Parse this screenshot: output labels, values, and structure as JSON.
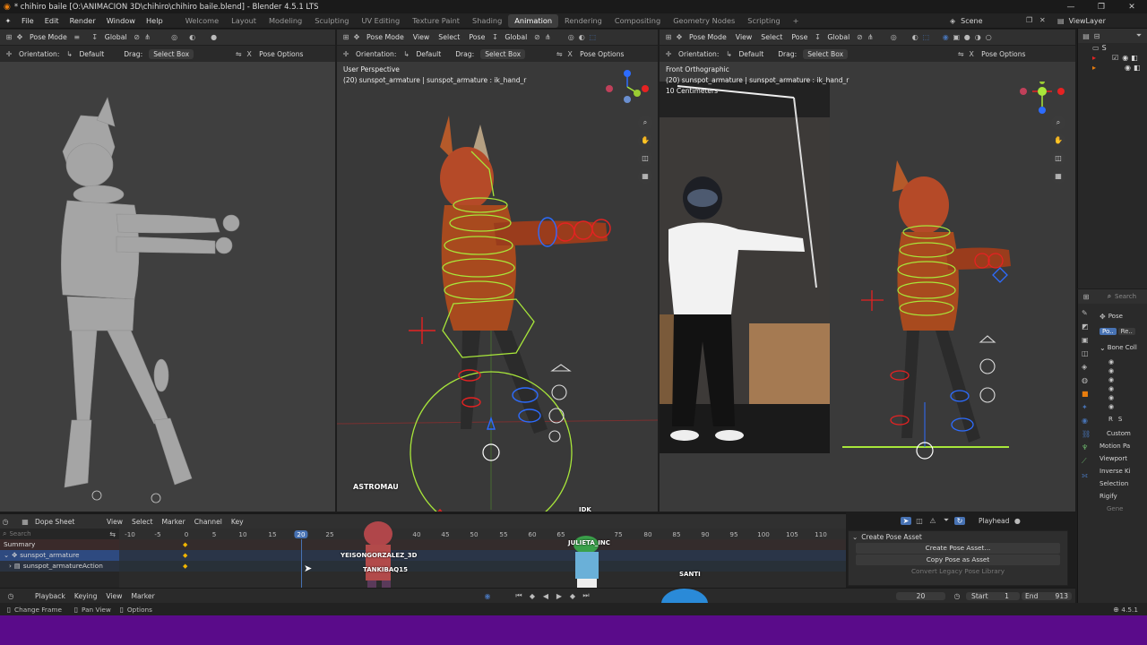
{
  "window": {
    "title": "* chihiro baile [O:\\ANIMACION 3D\\chihiro\\chihiro baile.blend] - Blender 4.5.1 LTS",
    "controls": [
      "—",
      "❐",
      "✕"
    ]
  },
  "menu": [
    "File",
    "Edit",
    "Render",
    "Window",
    "Help"
  ],
  "workspaces": [
    "Welcome",
    "Layout",
    "Modeling",
    "Sculpting",
    "UV Editing",
    "Texture Paint",
    "Shading",
    "Animation",
    "Rendering",
    "Compositing",
    "Geometry Nodes",
    "Scripting"
  ],
  "active_workspace": "Animation",
  "scene": "Scene",
  "view_layer": "ViewLayer",
  "viewport_left": {
    "mode": "Pose Mode",
    "transform": "Global",
    "orientation_label": "Orientation:",
    "orientation": "Default",
    "drag_label": "Drag:",
    "drag": "Select Box",
    "pose_options": "Pose Options"
  },
  "viewport_center": {
    "mode": "Pose Mode",
    "view": "View",
    "select": "Select",
    "pose": "Pose",
    "transform": "Global",
    "orientation_label": "Orientation:",
    "orientation": "Default",
    "drag_label": "Drag:",
    "drag": "Select Box",
    "pose_options": "Pose Options",
    "perspective": "User Perspective",
    "info": "(20) sunspot_armature | sunspot_armature : ik_hand_r",
    "watermark": "ASTROMAU"
  },
  "viewport_right": {
    "mode": "Pose Mode",
    "view": "View",
    "select": "Select",
    "pose": "Pose",
    "transform": "Global",
    "orientation_label": "Orientation:",
    "orientation": "Default",
    "drag_label": "Drag:",
    "drag": "Select Box",
    "pose_options": "Pose Options",
    "perspective": "Front Orthographic",
    "info": "(20) sunspot_armature | sunspot_armature : ik_hand_r",
    "scale": "10 Centimeters"
  },
  "dope_sheet": {
    "editor": "Dope Sheet",
    "menus": [
      "View",
      "Select",
      "Marker",
      "Channel",
      "Key"
    ],
    "search_placeholder": "Search",
    "playhead": "Playhead",
    "ruler": [
      "-10",
      "-5",
      "0",
      "5",
      "10",
      "15",
      "20",
      "25",
      "40",
      "45",
      "50",
      "55",
      "60",
      "65",
      "75",
      "80",
      "85",
      "90",
      "95",
      "100",
      "105",
      "110"
    ],
    "current_frame": "20",
    "channels": [
      "Summary",
      "sunspot_armature",
      "sunspot_armatureAction"
    ],
    "overlay_names": [
      "YEISONGORZALEZ_3D",
      "TANKIBAQ15",
      "JULIETA_INC",
      "SANTI",
      "IDK"
    ]
  },
  "asset_panel": {
    "title": "Create Pose Asset",
    "create": "Create Pose Asset...",
    "copy": "Copy Pose as Asset",
    "legacy": "Convert Legacy Pose Library"
  },
  "timeline": {
    "menus": [
      "Playback",
      "Keying",
      "View",
      "Marker"
    ],
    "frame": "20",
    "start_label": "Start",
    "start": "1",
    "end_label": "End",
    "end": "913"
  },
  "status": {
    "items": [
      "Change Frame",
      "Pan View",
      "Options"
    ],
    "version": "4.5.1"
  },
  "properties": {
    "search_placeholder": "Search",
    "pose_label": "Pose",
    "pose_tab1": "Po..",
    "pose_tab2": "Re..",
    "bone_collections": "Bone Coll",
    "r_label": "R",
    "s_label": "S",
    "sections": [
      "Custom",
      "Motion Pa",
      "Viewport",
      "Inverse Ki",
      "Selection",
      "Rigify",
      "Gene"
    ]
  },
  "colors": {
    "accent": "#4772b3",
    "purple_bar": "#5a0b8a",
    "rig_green": "#a8e63a",
    "rig_red": "#e52222",
    "rig_blue": "#2d6cff",
    "keyframe": "#f0b400"
  }
}
